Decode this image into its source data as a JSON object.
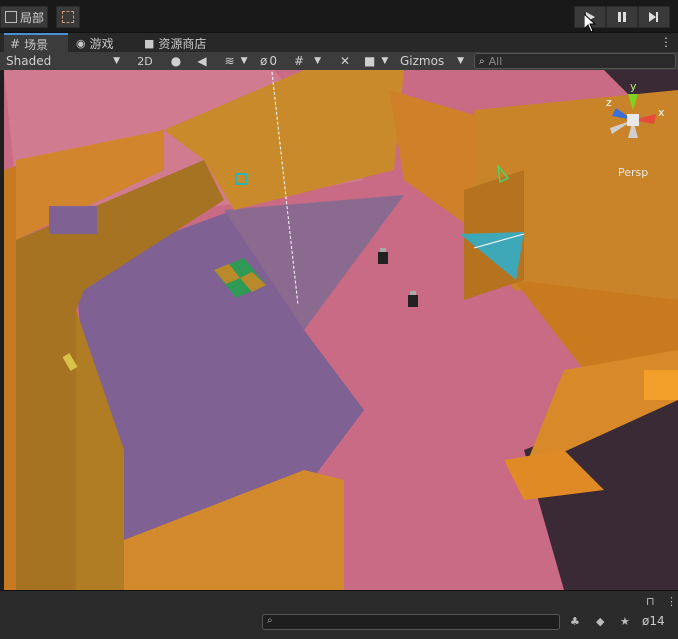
{
  "top": {
    "tab_local": "局部",
    "play_icon": "play-icon",
    "pause_icon": "pause-icon",
    "step_icon": "step-icon"
  },
  "tabs": [
    {
      "label": "场景",
      "icon": "grid-icon",
      "active": true
    },
    {
      "label": "游戏",
      "icon": "gamepad-icon",
      "active": false
    },
    {
      "label": "资源商店",
      "icon": "bag-icon",
      "active": false
    }
  ],
  "scene_toolbar": {
    "shading_mode": "Shaded",
    "two_d": "2D",
    "hidden_count": "0",
    "gizmos": "Gizmos",
    "search_placeholder": "All"
  },
  "gizmo": {
    "persp_label": "Persp",
    "axis_x": "x",
    "axis_y": "y",
    "axis_z": "z"
  },
  "bottom": {
    "hidden_layers": "14"
  },
  "colors": {
    "wall": "#d88426",
    "floor": "#c96b84",
    "shadow": "#7a5e8c",
    "accent_blue": "#4a90d9"
  }
}
